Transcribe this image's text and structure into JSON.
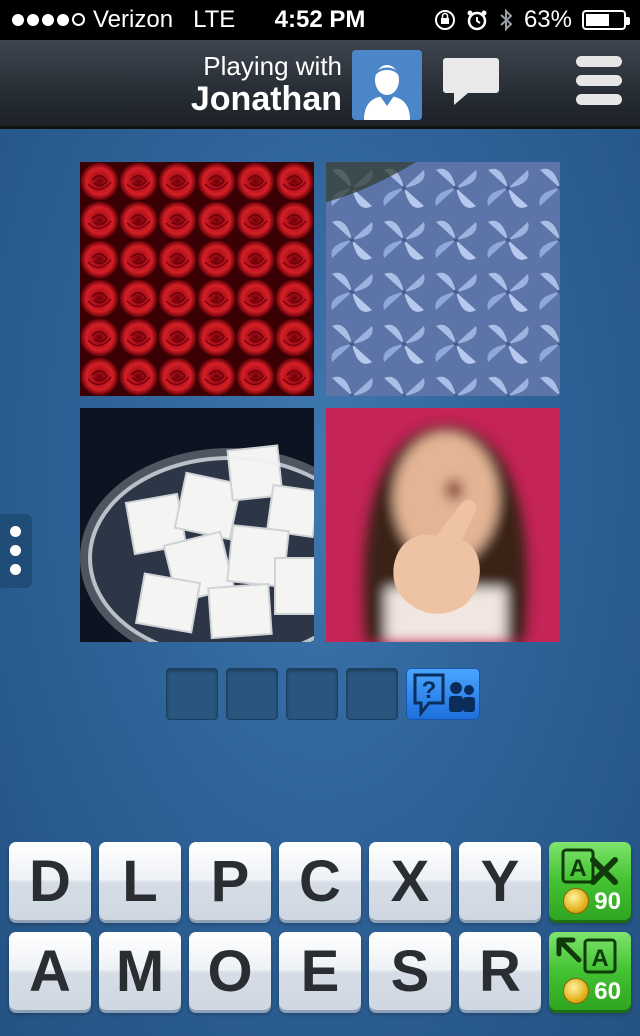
{
  "status_bar": {
    "carrier": "Verizon",
    "network": "LTE",
    "time": "4:52 PM",
    "battery": "63%",
    "battery_level": 0.63,
    "signal_bars_filled": 4,
    "signal_bars_total": 5
  },
  "header": {
    "playing_with_label": "Playing with",
    "opponent_name": "Jonathan",
    "icons": [
      "avatar-icon",
      "chat-icon",
      "menu-icon"
    ]
  },
  "puzzle": {
    "images": [
      {
        "name": "red roses",
        "icon": "roses-image"
      },
      {
        "name": "blue hydrangea",
        "icon": "hydrangea-image"
      },
      {
        "name": "sugar cubes in bowl",
        "icon": "sugar-image"
      },
      {
        "name": "girl pointing",
        "icon": "pointing-image"
      }
    ],
    "answer_slots": [
      "",
      "",
      "",
      ""
    ],
    "help_icon": "ask-friends-icon"
  },
  "keyboard": {
    "row1": [
      "D",
      "L",
      "P",
      "C",
      "X",
      "Y"
    ],
    "row2": [
      "A",
      "M",
      "O",
      "E",
      "S",
      "R"
    ],
    "remove_letters": {
      "cost": "90",
      "icon": "remove-letters-icon"
    },
    "reveal_letter": {
      "cost": "60",
      "icon": "reveal-letter-icon"
    }
  },
  "colors": {
    "background": "#2f6399",
    "header": "#2b3139",
    "key_text": "#2a2e33",
    "power_up_green": "#43c232",
    "help_blue": "#1e6fdc"
  }
}
